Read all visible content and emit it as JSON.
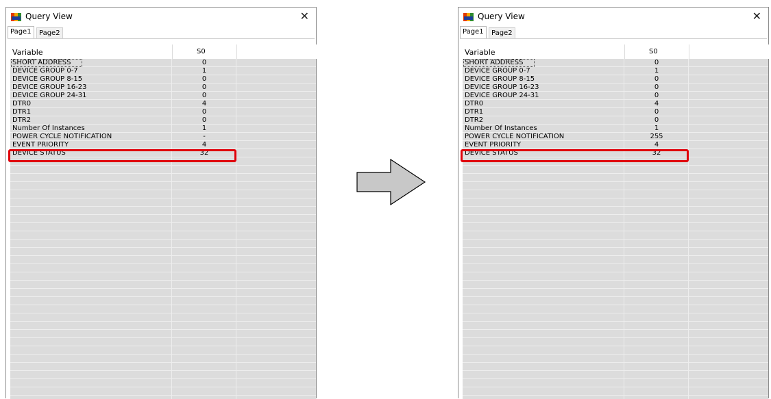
{
  "windows": [
    {
      "title": "Query View",
      "close_glyph": "✕",
      "tabs": [
        {
          "label": "Page1",
          "active": true
        },
        {
          "label": "Page2",
          "active": false
        }
      ],
      "columns": [
        "Variable",
        "S0"
      ],
      "rows": [
        {
          "variable": "SHORT ADDRESS",
          "value": "0"
        },
        {
          "variable": "DEVICE GROUP 0-7",
          "value": "1"
        },
        {
          "variable": "DEVICE GROUP 8-15",
          "value": "0"
        },
        {
          "variable": "DEVICE GROUP 16-23",
          "value": "0"
        },
        {
          "variable": "DEVICE GROUP 24-31",
          "value": "0"
        },
        {
          "variable": "DTR0",
          "value": "4"
        },
        {
          "variable": "DTR1",
          "value": "0"
        },
        {
          "variable": "DTR2",
          "value": "0"
        },
        {
          "variable": "Number Of Instances",
          "value": "1"
        },
        {
          "variable": "POWER CYCLE NOTIFICATION",
          "value": "-"
        },
        {
          "variable": "EVENT PRIORITY",
          "value": "4"
        },
        {
          "variable": "DEVICE STATUS",
          "value": "32"
        }
      ],
      "highlighted_row": "POWER CYCLE NOTIFICATION"
    },
    {
      "title": "Query View",
      "close_glyph": "✕",
      "tabs": [
        {
          "label": "Page1",
          "active": true
        },
        {
          "label": "Page2",
          "active": false
        }
      ],
      "columns": [
        "Variable",
        "S0"
      ],
      "rows": [
        {
          "variable": "SHORT ADDRESS",
          "value": "0"
        },
        {
          "variable": "DEVICE GROUP 0-7",
          "value": "1"
        },
        {
          "variable": "DEVICE GROUP 8-15",
          "value": "0"
        },
        {
          "variable": "DEVICE GROUP 16-23",
          "value": "0"
        },
        {
          "variable": "DEVICE GROUP 24-31",
          "value": "0"
        },
        {
          "variable": "DTR0",
          "value": "4"
        },
        {
          "variable": "DTR1",
          "value": "0"
        },
        {
          "variable": "DTR2",
          "value": "0"
        },
        {
          "variable": "Number Of Instances",
          "value": "1"
        },
        {
          "variable": "POWER CYCLE NOTIFICATION",
          "value": "255"
        },
        {
          "variable": "EVENT PRIORITY",
          "value": "4"
        },
        {
          "variable": "DEVICE STATUS",
          "value": "32"
        }
      ],
      "highlighted_row": "POWER CYCLE NOTIFICATION"
    }
  ],
  "icons": {
    "app": "dali-app-icon",
    "close": "close-icon",
    "transition": "right-arrow-icon"
  },
  "colors": {
    "highlight": "#e0000a",
    "grid_bg": "#dcdcdc",
    "arrow_fill": "#c8c8c8"
  }
}
